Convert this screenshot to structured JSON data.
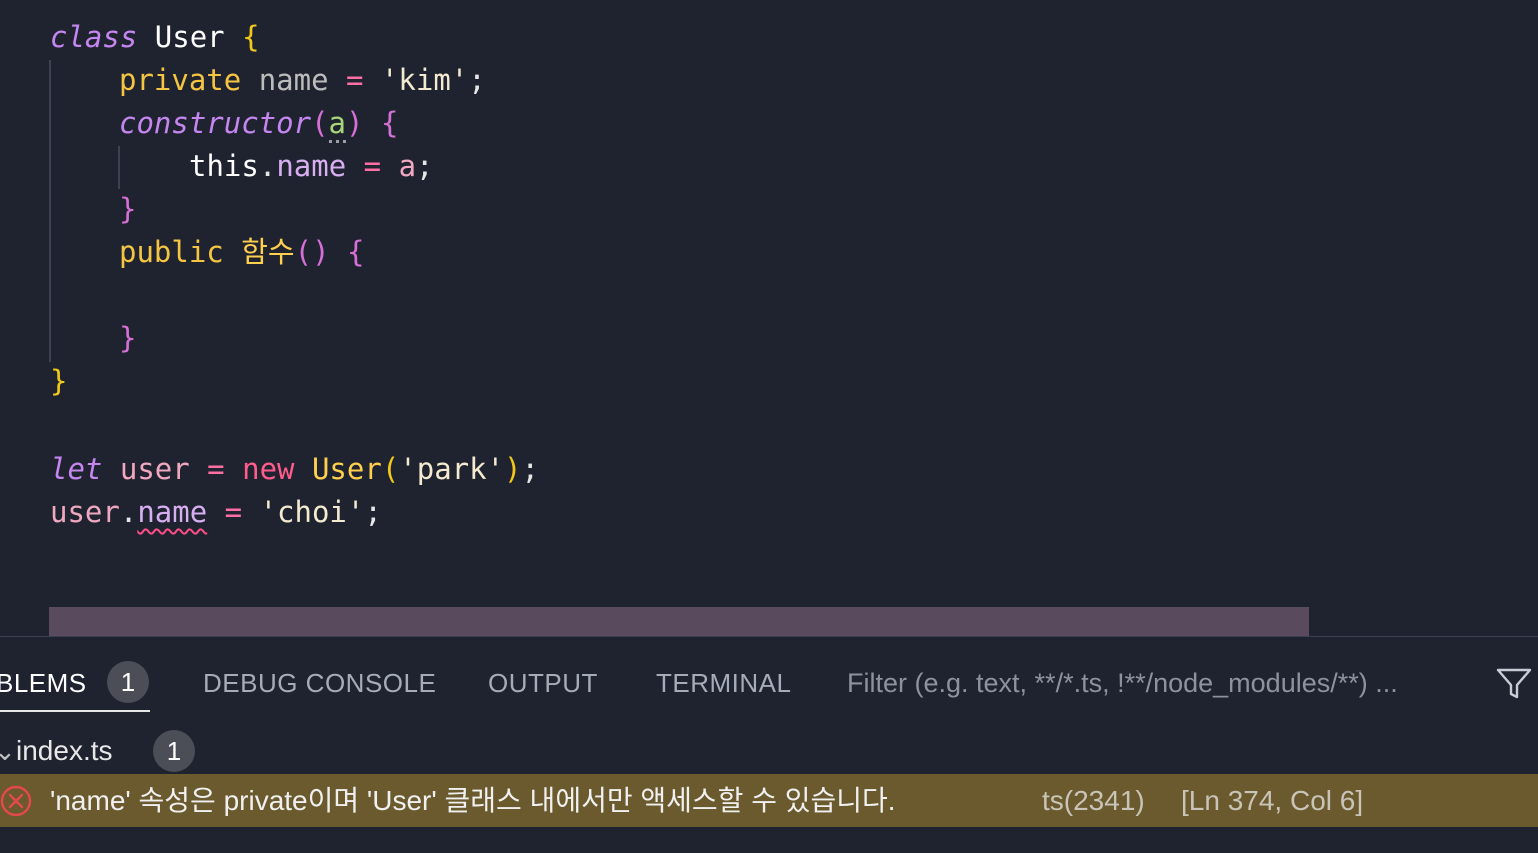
{
  "editor": {
    "lines": {
      "l1": {
        "kw": "class",
        "name": "User",
        "brace": "{"
      },
      "l2": {
        "mod": "private",
        "prop": "name",
        "op": "=",
        "str": "'kim'",
        "semi": ";"
      },
      "l3": {
        "fn": "constructor",
        "open": "(",
        "param": "a",
        "close": ")",
        "brace": "{"
      },
      "l4": {
        "this": "this",
        "dot": ".",
        "member": "name",
        "op": "=",
        "val": "a",
        "semi": ";"
      },
      "l5": {
        "brace": "}"
      },
      "l6": {
        "mod": "public",
        "fn": "함수",
        "parens": "()",
        "brace": "{"
      },
      "l7": {
        "brace": "}"
      },
      "l8": {
        "brace": "}"
      },
      "l9": {
        "kw": "let",
        "var": "user",
        "op": "=",
        "new": "new",
        "ctor": "User",
        "open": "(",
        "str": "'park'",
        "close": ")",
        "semi": ";"
      },
      "l10": {
        "var": "user",
        "dot": ".",
        "member": "name",
        "op": "=",
        "str": "'choi'",
        "semi": ";"
      }
    }
  },
  "panel": {
    "tabs": {
      "problems": {
        "label": "BLEMS",
        "count": "1"
      },
      "debug": {
        "label": "DEBUG CONSOLE"
      },
      "output": {
        "label": "OUTPUT"
      },
      "terminal": {
        "label": "TERMINAL"
      }
    },
    "filter_placeholder": "Filter (e.g. text, **/*.ts, !**/node_modules/**) ...",
    "file": {
      "name": "index.ts",
      "count": "1"
    },
    "error": {
      "message": "'name' 속성은 private이며 'User' 클래스 내에서만 액세스할 수 있습니다.",
      "code": "ts(2341)",
      "location": "[Ln 374, Col 6]"
    }
  },
  "colors": {
    "background": "#1f2330",
    "error_row": "#6b5a2e",
    "scrollbar": "#594a5e",
    "error_icon": "#e5484d"
  },
  "icons": {
    "filter": "filter-icon",
    "error": "error-circle-icon"
  }
}
